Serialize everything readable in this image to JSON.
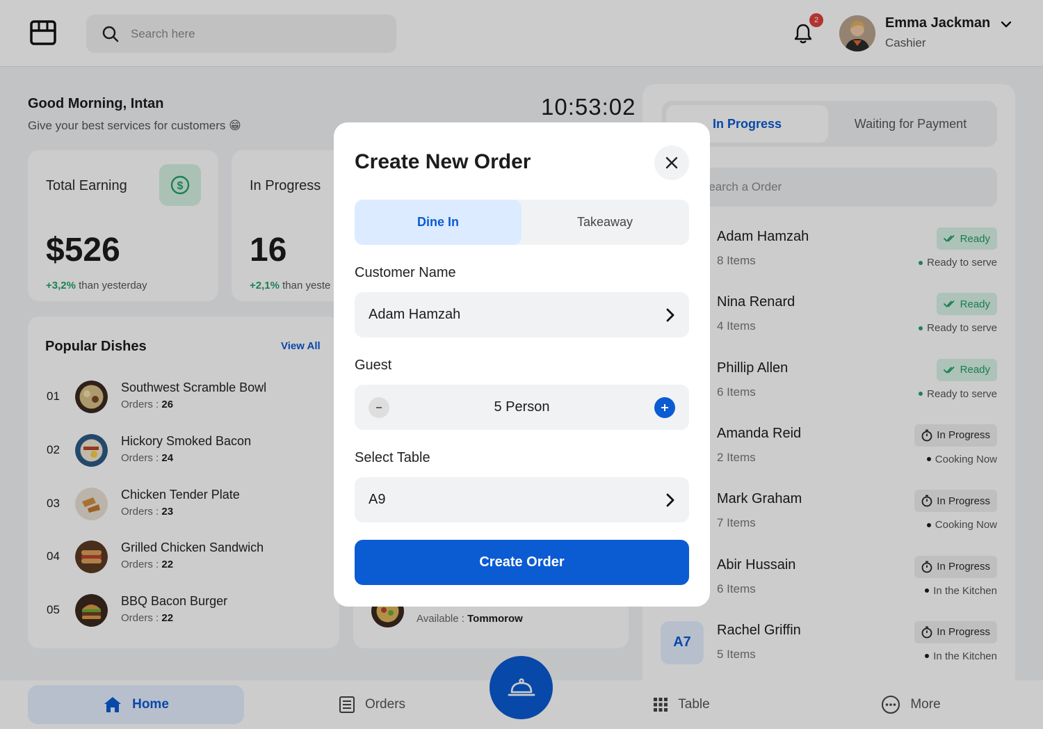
{
  "header": {
    "search_placeholder": "Search here",
    "notification_count": "2",
    "user_name": "Emma Jackman",
    "user_role": "Cashier"
  },
  "greeting": {
    "title": "Good Morning, Intan",
    "subtitle": "Give your best services for customers 😁",
    "clock": "10:53:02"
  },
  "stats": [
    {
      "title": "Total Earning",
      "value": "$526",
      "delta": "+3,2%",
      "delta_text": " than yesterday"
    },
    {
      "title": "In Progress",
      "value": "16",
      "delta": "+2,1%",
      "delta_text": " than yeste"
    }
  ],
  "popular": {
    "title": "Popular Dishes",
    "view_all": "View All",
    "orders_label": "Orders : ",
    "items": [
      {
        "num": "01",
        "name": "Southwest Scramble Bowl",
        "orders": "26"
      },
      {
        "num": "02",
        "name": "Hickory Smoked Bacon",
        "orders": "24"
      },
      {
        "num": "03",
        "name": "Chicken Tender Plate",
        "orders": "23"
      },
      {
        "num": "04",
        "name": "Grilled Chicken Sandwich",
        "orders": "22"
      },
      {
        "num": "05",
        "name": "BBQ Bacon Burger",
        "orders": "22"
      }
    ]
  },
  "oos": {
    "available_label": "Available : ",
    "available_value": "Tommorow"
  },
  "orders_panel": {
    "tab_active": "In Progress",
    "tab_inactive": "Waiting for Payment",
    "search_placeholder": "Search a Order",
    "orders": [
      {
        "name": "Adam Hamzah",
        "items": "8 Items",
        "badge": "Ready",
        "status": "Ready to serve",
        "status_color": "#23a26d"
      },
      {
        "name": "Nina Renard",
        "items": "4 Items",
        "badge": "Ready",
        "status": "Ready to serve",
        "status_color": "#23a26d"
      },
      {
        "name": "Phillip Allen",
        "items": "6 Items",
        "badge": "Ready",
        "status": "Ready to serve",
        "status_color": "#23a26d"
      },
      {
        "name": "Amanda Reid",
        "items": "2 Items",
        "badge": "In Progress",
        "status": "Cooking Now",
        "status_color": "#1c1c1c"
      },
      {
        "name": "Mark Graham",
        "items": "7 Items",
        "badge": "In Progress",
        "status": "Cooking Now",
        "status_color": "#1c1c1c"
      },
      {
        "name": "Abir Hussain",
        "items": "6 Items",
        "badge": "In Progress",
        "status": "In the Kitchen",
        "status_color": "#1c1c1c"
      },
      {
        "name": "Rachel Griffin",
        "items": "5 Items",
        "badge": "In Progress",
        "status": "In the Kitchen",
        "status_color": "#1c1c1c",
        "table": "A7"
      }
    ]
  },
  "nav": {
    "home": "Home",
    "orders": "Orders",
    "table": "Table",
    "more": "More"
  },
  "modal": {
    "title": "Create New Order",
    "dine_in": "Dine In",
    "takeaway": "Takeaway",
    "customer_label": "Customer Name",
    "customer_value": "Adam Hamzah",
    "guest_label": "Guest",
    "guest_value": "5 Person",
    "table_label": "Select Table",
    "table_value": "A9",
    "submit": "Create Order"
  },
  "colors": {
    "accent": "#0b5bd3",
    "success": "#23a26d",
    "badge_red": "#e0403c"
  }
}
